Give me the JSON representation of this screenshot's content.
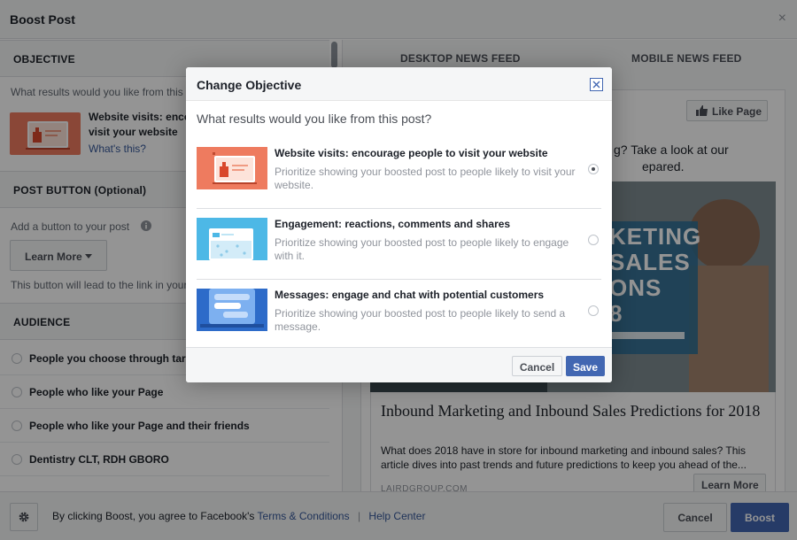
{
  "window": {
    "title": "Boost Post",
    "close_glyph": "×"
  },
  "left": {
    "objective": {
      "heading": "OBJECTIVE",
      "question": "What results would you like from this",
      "selected_title_line1": "Website visits: enco",
      "selected_title_line2": "visit your website",
      "whats_this": "What's this?"
    },
    "post_button": {
      "heading": "POST BUTTON (Optional)",
      "add_label": "Add a button to your post",
      "button_label": "Learn More",
      "hint": "This button will lead to the link in your"
    },
    "audience": {
      "heading": "AUDIENCE",
      "options": [
        "People you choose through targ",
        "People who like your Page",
        "People who like your Page and their friends",
        "Dentistry CLT, RDH GBORO"
      ]
    }
  },
  "right": {
    "tabs": [
      "DESKTOP NEWS FEED",
      "MOBILE NEWS FEED"
    ],
    "like_page": "Like Page",
    "post_line1": "g? Take a look at our",
    "post_line2": "epared.",
    "image_text": [
      "KETING",
      "SALES",
      "ONS",
      "8"
    ],
    "link_title": "Inbound Marketing and Inbound Sales Predictions for 2018",
    "link_desc": "What does 2018 have in store for inbound marketing and inbound sales? This article dives into past trends and future predictions to keep you ahead of the...",
    "link_domain": "LAIRDGROUP.COM",
    "learn_more": "Learn More"
  },
  "footer": {
    "agree_text": "By clicking Boost, you agree to Facebook's",
    "terms": "Terms & Conditions",
    "separator": "|",
    "help": "Help Center",
    "cancel": "Cancel",
    "boost": "Boost"
  },
  "modal": {
    "title": "Change Objective",
    "question": "What results would you like from this post?",
    "options": [
      {
        "title": "Website visits: encourage people to visit your website",
        "desc": "Prioritize showing your boosted post to people likely to visit your website.",
        "selected": true
      },
      {
        "title": "Engagement: reactions, comments and shares",
        "desc": "Prioritize showing your boosted post to people likely to engage with it.",
        "selected": false
      },
      {
        "title": "Messages: engage and chat with potential customers",
        "desc": "Prioritize showing your boosted post to people likely to send a message.",
        "selected": false
      }
    ],
    "cancel": "Cancel",
    "save": "Save"
  },
  "colors": {
    "brand_blue": "#4267b2",
    "link_blue": "#365899",
    "website_visits_bg": "#ee7b5f",
    "engagement_bg": "#4db8e6",
    "messages_bg": "#2d6bc9"
  },
  "icons": [
    "close-icon",
    "info-icon",
    "caret-down-icon",
    "thumbs-up-icon",
    "gear-icon"
  ]
}
